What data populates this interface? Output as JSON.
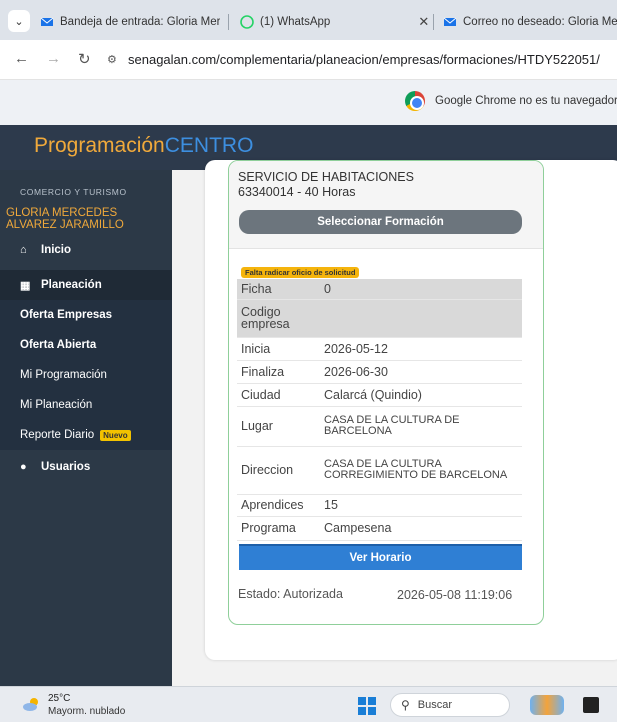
{
  "browser": {
    "tabs": [
      {
        "title": "Bandeja de entrada: Gloria Mer",
        "icon": "mail-icon"
      },
      {
        "title": "(1) WhatsApp",
        "icon": "whatsapp-icon"
      },
      {
        "title": "Correo no deseado: Gloria Mer",
        "icon": "mail-icon"
      }
    ],
    "url": "senagalan.com/complementaria/planeacion/empresas/formaciones/HTDY522051/",
    "infobar_text": "Google Chrome no es tu navegador p"
  },
  "app": {
    "brand_part1": "Programación",
    "brand_part2": "CENTRO"
  },
  "sidebar": {
    "section": "COMERCIO Y TURISMO",
    "user_line1": "GLORIA MERCEDES",
    "user_line2": "ALVAREZ JARAMILLO",
    "items": [
      {
        "label": "Inicio",
        "icon": "home-icon"
      },
      {
        "label": "Planeación",
        "icon": "calendar-icon"
      },
      {
        "label": "Oferta Empresas"
      },
      {
        "label": "Oferta Abierta"
      },
      {
        "label": "Mi Programación"
      },
      {
        "label": "Mi Planeación"
      },
      {
        "label": "Reporte Diario",
        "badge": "Nuevo"
      },
      {
        "label": "Usuarios",
        "icon": "user-icon"
      }
    ]
  },
  "card": {
    "course_name": "SERVICIO DE HABITACIONES",
    "course_code": "63340014 - 40 Horas",
    "select_button": "Seleccionar Formación",
    "warning": "Falta radicar oficio de solicitud",
    "rows": [
      {
        "label": "Ficha",
        "value": "0"
      },
      {
        "label": "Codigo empresa",
        "value": ""
      },
      {
        "label": "Inicia",
        "value": "2026-05-12"
      },
      {
        "label": "Finaliza",
        "value": "2026-06-30"
      },
      {
        "label": "Ciudad",
        "value": "Calarcá (Quindio)"
      },
      {
        "label": "Lugar",
        "value": "CASA DE LA CULTURA DE BARCELONA"
      },
      {
        "label": "Direccion",
        "value": "CASA DE LA CULTURA CORREGIMIENTO DE BARCELONA"
      },
      {
        "label": "Aprendices",
        "value": "15"
      },
      {
        "label": "Programa",
        "value": "Campesena"
      }
    ],
    "horario_button": "Ver Horario",
    "estado": "Estado: Autorizada",
    "fecha": "2026-05-08 11:19:06"
  },
  "taskbar": {
    "temp": "25°C",
    "weather": "Mayorm. nublado",
    "search": "Buscar"
  }
}
